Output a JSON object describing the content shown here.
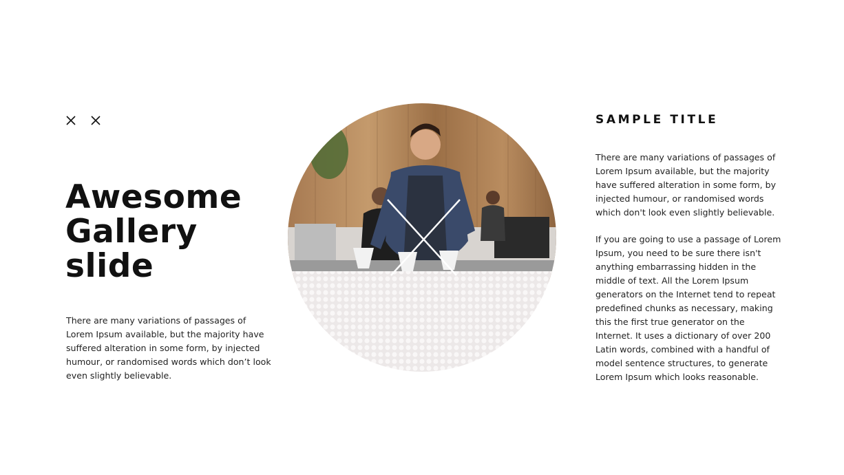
{
  "slide": {
    "title": "Awesome\nGallery\nslide",
    "body": "There are many variations of passages of Lorem Ipsum available, but the majority have suffered alteration in some form, by injected humour, or randomised words which don’t look even slightly believable."
  },
  "icons": [
    "close-x-icon",
    "close-x-icon"
  ],
  "photo": {
    "subject": "barista-at-coffee-counter-photo"
  },
  "sidebar": {
    "title": "SAMPLE TITLE",
    "paragraph_1": "There are many variations of passages of Lorem Ipsum available, but the majority have suffered alteration in some form, by injected humour, or randomised words which don't look even slightly believable.",
    "paragraph_2": "If you are going to use a passage of Lorem Ipsum, you need to be sure there isn't anything embarrassing hidden in the middle of text. All the Lorem Ipsum generators on the Internet tend to repeat predefined chunks as necessary, making this the first true generator on the Internet. It uses a dictionary of over 200 Latin words, combined with a handful of model sentence structures, to generate Lorem Ipsum which looks reasonable."
  }
}
